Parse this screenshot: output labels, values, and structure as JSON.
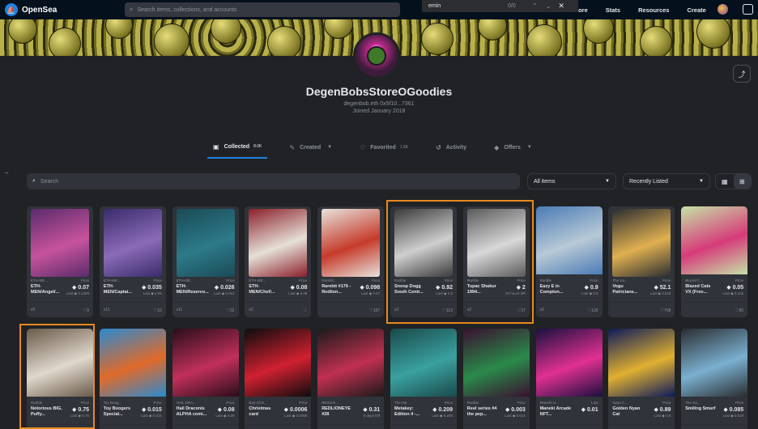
{
  "nav": {
    "brand": "OpenSea",
    "search_placeholder": "Search items, collections, and accounts",
    "links": [
      "lore",
      "Stats",
      "Resources",
      "Create"
    ]
  },
  "findbar": {
    "query": "emin",
    "count": "0/0"
  },
  "profile": {
    "name": "DegenBobsStoreOGoodies",
    "address": "degenbob.eth  0x5f10...7361",
    "joined": "Joined January 2018"
  },
  "tabs": [
    {
      "label": "Collected",
      "count": "8.0K"
    },
    {
      "label": "Created",
      "count": ""
    },
    {
      "label": "Favorited",
      "count": "1.5K"
    },
    {
      "label": "Activity",
      "count": ""
    },
    {
      "label": "Offers",
      "count": ""
    }
  ],
  "filters": {
    "search_placeholder": "Search",
    "items_select": "All items",
    "sort_select": "Recently Listed"
  },
  "cards": [
    {
      "collection": "ETH-ME...",
      "name": "ETH-MEN/Angel/...",
      "price_label": "Price",
      "price": "0.07",
      "last": "Last ◆ 0.1299",
      "qty": "x5",
      "likes": "9",
      "colors": [
        "#5a2b6b",
        "#c7539c"
      ]
    },
    {
      "collection": "ETH-ME...",
      "name": "ETH-MEN/Captai...",
      "price_label": "Price",
      "price": "0.035",
      "last": "Last ◆ 0.25",
      "qty": "x11",
      "likes": "10",
      "colors": [
        "#3a2b6b",
        "#8a6bb7"
      ]
    },
    {
      "collection": "ETH-ME...",
      "name": "ETH-MEN/Reservo...",
      "price_label": "Price",
      "price": "0.026",
      "last": "Last ◆ 0.023",
      "qty": "x11",
      "likes": "32",
      "colors": [
        "#1a4a55",
        "#2d7a8a"
      ]
    },
    {
      "collection": "ETH-ME...",
      "name": "ETH-MEN/Chef/...",
      "price_label": "Price",
      "price": "0.08",
      "last": "Last ◆ 0.08",
      "qty": "x2",
      "likes": "",
      "colors": [
        "#8a1f2b",
        "#e6e0d6"
      ]
    },
    {
      "collection": "Rarebit...",
      "name": "Rarebit #176 - Redlion...",
      "price_label": "Price",
      "price": "0.098",
      "last": "Last ◆ 0.07",
      "qty": "",
      "likes": "157",
      "colors": [
        "#e7e3dd",
        "#c63b2b"
      ]
    },
    {
      "collection": "Rarible",
      "name": "Snoop Dogg South Centr...",
      "price_label": "Price",
      "price": "0.92",
      "last": "Last ◆ 0.5",
      "qty": "x3",
      "likes": "113",
      "colors": [
        "#3a3a3a",
        "#cfcfcf"
      ]
    },
    {
      "collection": "Rarible",
      "name": "Tupac Shakur 1994...",
      "price_label": "Price",
      "price": "2",
      "last": "20 hours left",
      "qty": "x2",
      "likes": "37",
      "colors": [
        "#5a5a5a",
        "#d8d8d8"
      ]
    },
    {
      "collection": "Rarible",
      "name": "Eazy E in Compton...",
      "price_label": "Price",
      "price": "0.9",
      "last": "Last ◆ 0.8",
      "qty": "x2",
      "likes": "126",
      "colors": [
        "#4a7bb5",
        "#b8c9d6"
      ]
    },
    {
      "collection": "The Sa...",
      "name": "Vogu Patriciane...",
      "price_label": "Price",
      "price": "52.1",
      "last": "Last ◆ 0.018",
      "qty": "",
      "likes": "768",
      "colors": [
        "#2a2d31",
        "#e0b050"
      ]
    },
    {
      "collection": "Blazed C...",
      "name": "Blazed Cats VX (Free...",
      "price_label": "Price",
      "price": "0.05",
      "last": "Last ◆ 0.133",
      "qty": "",
      "likes": "80",
      "colors": [
        "#c6e3a6",
        "#d63b7a"
      ]
    },
    {
      "collection": "Rarible",
      "name": "Notorious BIG, Puffy...",
      "price_label": "Price",
      "price": "0.75",
      "last": "Last ◆ 0.75",
      "qty": "",
      "likes": "",
      "colors": [
        "#6a5a4a",
        "#e0d8cc"
      ]
    },
    {
      "collection": "Toy Boog...",
      "name": "Toy Boogers Special...",
      "price_label": "Price",
      "price": "0.015",
      "last": "Last ◆ 0.015",
      "qty": "",
      "likes": "",
      "colors": [
        "#2a8ad0",
        "#e06a2a"
      ]
    },
    {
      "collection": "HAIL DRA...",
      "name": "Hail Draconis ALPHA comi...",
      "price_label": "Price",
      "price": "0.08",
      "last": "Last ◆ 0.09",
      "qty": "",
      "likes": "",
      "colors": [
        "#2a0d1a",
        "#c0305a"
      ]
    },
    {
      "collection": "Bad Girls...",
      "name": "Christmas card",
      "price_label": "Price",
      "price": "0.0006",
      "last": "Last ◆ 0.0006",
      "qty": "",
      "likes": "",
      "colors": [
        "#0d0d0d",
        "#d02030"
      ]
    },
    {
      "collection": "REDLIO...",
      "name": "REDLIONEYE #28",
      "price_label": "",
      "price": "0.31",
      "last": "5 days left",
      "qty": "",
      "likes": "",
      "colors": [
        "#1a1a1a",
        "#c03050"
      ]
    },
    {
      "collection": "The Me...",
      "name": "Metakey: Edition 4 -...",
      "price_label": "Price",
      "price": "0.209",
      "last": "Last ◆ 0.209",
      "qty": "",
      "likes": "",
      "colors": [
        "#1a4a4a",
        "#3aa0a0"
      ]
    },
    {
      "collection": "Rarible",
      "name": "Reel series #4 the pep...",
      "price_label": "Price",
      "price": "0.003",
      "last": "Last ◆ 0.014",
      "qty": "",
      "likes": "",
      "colors": [
        "#3a1030",
        "#2a8a4a"
      ]
    },
    {
      "collection": "Maneki Ar...",
      "name": "Maneki Arcade NFT...",
      "price_label": "Last",
      "price": "0.01",
      "last": "",
      "qty": "",
      "likes": "",
      "colors": [
        "#1a1040",
        "#e03090"
      ]
    },
    {
      "collection": "Nyan C...",
      "name": "Golden Nyan Cat",
      "price_label": "Price",
      "price": "0.89",
      "last": "Last ◆ 0.9",
      "qty": "",
      "likes": "",
      "colors": [
        "#0d1a5a",
        "#e0b030"
      ]
    },
    {
      "collection": "The Sa...",
      "name": "Smiling Smurf",
      "price_label": "Price",
      "price": "0.085",
      "last": "Last ◆ 0.028",
      "qty": "",
      "likes": "",
      "colors": [
        "#2a2d31",
        "#7ab0d0"
      ]
    }
  ]
}
